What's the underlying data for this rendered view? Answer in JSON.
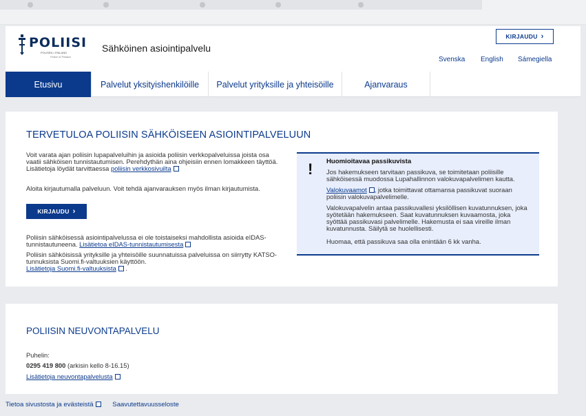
{
  "header": {
    "logo_word": "POLIISI",
    "logo_sub": "POLISEN • FINLAND",
    "logo_sub2": "Police of Finland",
    "site_title": "Sähköinen asiointipalvelu",
    "login_label": "KIRJAUDU",
    "login_arrow": "›",
    "languages": [
      "Svenska",
      "English",
      "Sámegiella"
    ]
  },
  "nav": {
    "tabs": [
      "Etusivu",
      "Palvelut yksityishenkilöille",
      "Palvelut yrityksille ja yhteisöille",
      "Ajanvaraus"
    ]
  },
  "welcome": {
    "title": "TERVETULOA POLIISIN SÄHKÖISEEN ASIOINTIPALVELUUN",
    "p1": "Voit varata ajan poliisin lupapalveluihin ja asioida poliisin verkkopalveluissa joista osa vaatii sähköisen tunnistautumisen. Perehdythän aina ohjeisiin ennen lomakkeen täyttöä. Lisätietoja löydät tarvittaessa",
    "p1_link": "poliisin verkkosivuilta",
    "p2": "Aloita kirjautumalla palveluun. Voit tehdä ajanvarauksen myös ilman kirjautumista.",
    "button": "KIRJAUDU",
    "button_arrow": "›",
    "p3": "Poliisin sähköisessä asiointipalvelussa ei ole toistaiseksi mahdollista asioida eIDAS-tunnistautuneena.",
    "p3_link": "Lisätietoa eIDAS-tunnistautumisesta",
    "p4": "Poliisin sähköisissä yrityksille ja yhteisöille suunnatuissa palveluissa on siirrytty KATSO-tunnuksista Suomi.fi-valtuuksien käyttöön.",
    "p4_link": "Lisätietoja Suomi.fi-valtuuksista",
    "p4_end": "."
  },
  "notice": {
    "icon": "!",
    "title": "Huomioitavaa passikuvista",
    "p1": "Jos hakemukseen tarvitaan passikuva, se toimitetaan poliisille sähköisessä muodossa Lupahallinnon valokuvapalvelimen kautta.",
    "p2_link": "Valokuvaamot",
    "p2": ", jotka toimittavat ottamansa passikuvat suoraan poliisin valokuvapalvelimelle.",
    "p3": "Valokuvapalvelin antaa passikuvallesi yksilöllisen kuvatunnuksen, joka syötetään hakemukseen. Saat kuvatunnuksen kuvaamosta, joka syöttää passikuvasi palvelimelle. Hakemusta ei saa vireille ilman kuvatunnusta. Säilytä se huolellisesti.",
    "p4": "Huomaa, että passikuva saa olla enintään 6 kk vanha."
  },
  "advice": {
    "title": "POLIISIN NEUVONTAPALVELU",
    "phone_label": "Puhelin:",
    "phone_number": "0295 419 800",
    "phone_hours": " (arkisin kello 8-16.15)",
    "link": "Lisätietoja neuvontapalvelusta"
  },
  "footer": {
    "link1": "Tietoa sivustosta ja evästeistä",
    "link2": "Saavutettavuusseloste"
  },
  "colors": {
    "primary": "#0b3a8c",
    "notice_bg": "#e8eefb",
    "page_bg": "#e9ebee"
  }
}
